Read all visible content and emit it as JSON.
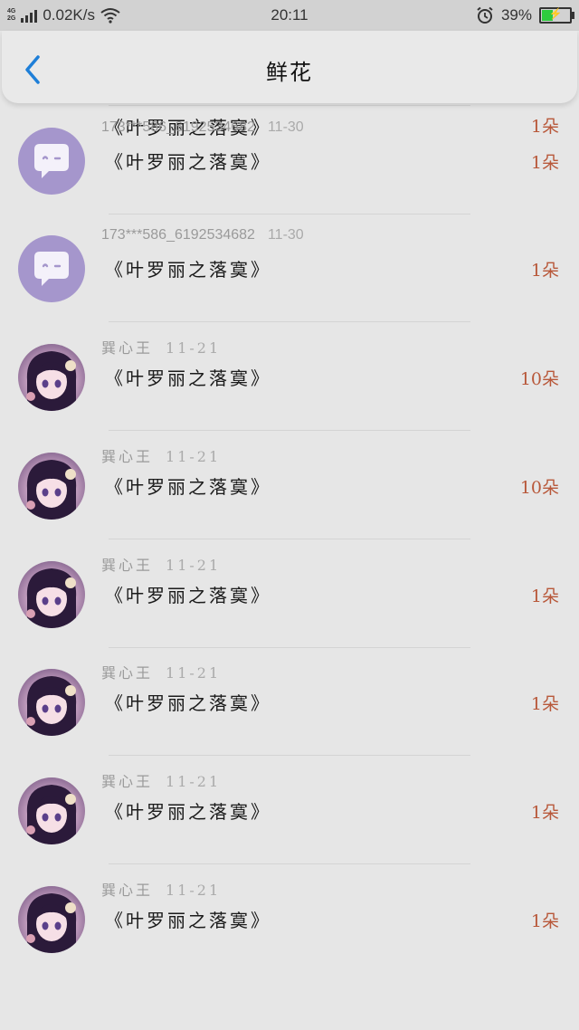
{
  "status_bar": {
    "network": [
      "4G",
      "2G"
    ],
    "speed": "0.02K/s",
    "time": "20:11",
    "battery": "39%",
    "battery_level": 0.39,
    "alarm_icon": "alarm-clock-icon",
    "wifi_icon": "wifi-icon",
    "accent": "#2ecb3e"
  },
  "header": {
    "title": "鲜花",
    "back_icon": "chevron-left-icon",
    "back_color": "#1e7fd8"
  },
  "records": [
    {
      "name": "",
      "date": "",
      "gift": "《叶罗丽之落寞》",
      "count": "1朵",
      "avatar": "chat-bubble"
    },
    {
      "name": "173***586_6192534682",
      "date": "11-30",
      "gift": "《叶罗丽之落寞》",
      "count": "1朵",
      "avatar": "chat-bubble"
    },
    {
      "name": "173***586_6192534682",
      "date": "11-30",
      "gift": "《叶罗丽之落寞》",
      "count": "1朵",
      "avatar": "chat-bubble"
    },
    {
      "name": "巽心王",
      "date": "11-21",
      "gift": "《叶罗丽之落寞》",
      "count": "10朵",
      "avatar": "anime-girl"
    },
    {
      "name": "巽心王",
      "date": "11-21",
      "gift": "《叶罗丽之落寞》",
      "count": "10朵",
      "avatar": "anime-girl"
    },
    {
      "name": "巽心王",
      "date": "11-21",
      "gift": "《叶罗丽之落寞》",
      "count": "1朵",
      "avatar": "anime-girl"
    },
    {
      "name": "巽心王",
      "date": "11-21",
      "gift": "《叶罗丽之落寞》",
      "count": "1朵",
      "avatar": "anime-girl"
    },
    {
      "name": "巽心王",
      "date": "11-21",
      "gift": "《叶罗丽之落寞》",
      "count": "1朵",
      "avatar": "anime-girl"
    },
    {
      "name": "巽心王",
      "date": "11-21",
      "gift": "《叶罗丽之落寞》",
      "count": "1朵",
      "avatar": "anime-girl"
    }
  ]
}
